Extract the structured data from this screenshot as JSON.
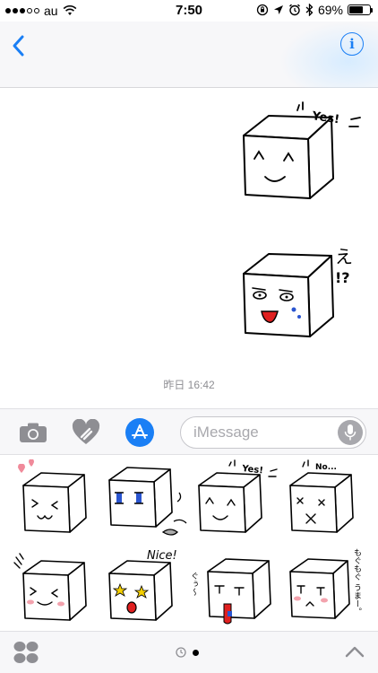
{
  "status_bar": {
    "carrier": "au",
    "time": "7:50",
    "battery_percent": "69%",
    "battery_level": 0.69,
    "signal_bars_filled": 3,
    "icons": [
      "wifi-icon",
      "orientation-lock-icon",
      "location-icon",
      "alarm-icon",
      "bluetooth-icon",
      "battery-icon"
    ]
  },
  "nav_bar": {
    "back_icon": "chevron-left-icon",
    "info_label": "i"
  },
  "conversation": {
    "stickers": [
      {
        "name": "sticker-yes-cube",
        "caption": "Yes!",
        "expression": "happy"
      },
      {
        "name": "sticker-e-cube",
        "caption": "え",
        "caption2": "!?",
        "expression": "surprised"
      }
    ],
    "timestamp": "昨日 16:42"
  },
  "input_bar": {
    "camera_icon": "camera-icon",
    "digital_touch_icon": "heart-touch-icon",
    "app_store_icon": "app-store-icon",
    "message_placeholder": "iMessage",
    "mic_icon": "microphone-icon"
  },
  "sticker_drawer": {
    "items": [
      {
        "name": "sticker-hearts",
        "caption": ""
      },
      {
        "name": "sticker-crying",
        "caption": ""
      },
      {
        "name": "sticker-yes",
        "caption": "Yes!"
      },
      {
        "name": "sticker-no",
        "caption": "No..."
      },
      {
        "name": "sticker-laugh",
        "caption": ""
      },
      {
        "name": "sticker-nice",
        "caption": "Nice!"
      },
      {
        "name": "sticker-sleepy",
        "caption": "ぐぅ〜"
      },
      {
        "name": "sticker-munch",
        "caption": "もぐもぐ うまー。"
      }
    ]
  },
  "bottom_bar": {
    "apps_icon": "apps-grid-icon",
    "recents_icon": "clock-icon",
    "expand_icon": "chevron-up-icon"
  },
  "colors": {
    "accent": "#1a7ff5",
    "bar_background": "#f7f7f9",
    "timestamp_gray": "#8e8e93"
  }
}
